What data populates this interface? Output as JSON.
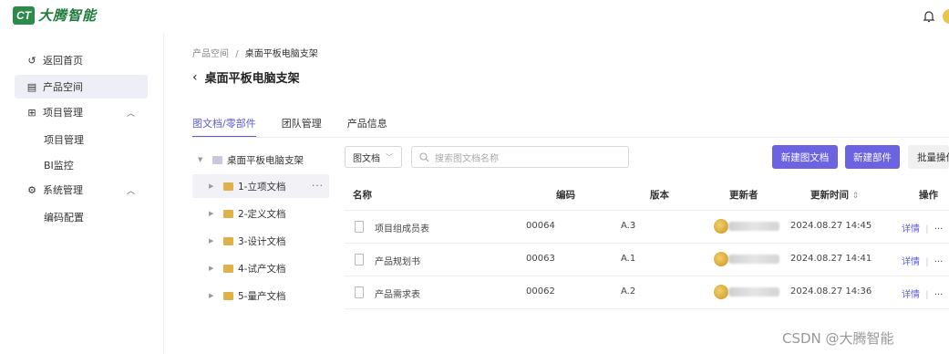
{
  "brand": {
    "logo_mark": "CT",
    "name": "大腾智能"
  },
  "sidebar": {
    "items": [
      {
        "label": "返回首页",
        "icon": "back-arrow-icon"
      },
      {
        "label": "产品空间",
        "icon": "product-space-icon",
        "active": true
      },
      {
        "label": "项目管理",
        "icon": "grid-icon",
        "expanded": true
      },
      {
        "label": "系统管理",
        "icon": "gear-icon",
        "expanded": true
      }
    ],
    "sub_project": [
      "项目管理",
      "BI监控"
    ],
    "sub_system": [
      "编码配置"
    ]
  },
  "breadcrumb": {
    "root": "产品空间",
    "sep": "/",
    "current": "桌面平板电脑支架"
  },
  "page": {
    "title": "桌面平板电脑支架",
    "back_glyph": "‹"
  },
  "tabs": [
    {
      "label": "图文档/零部件",
      "active": true
    },
    {
      "label": "团队管理"
    },
    {
      "label": "产品信息"
    }
  ],
  "tree": {
    "root": "桌面平板电脑支架",
    "folders": [
      "1-立项文档",
      "2-定义文档",
      "3-设计文档",
      "4-试产文档",
      "5-量产文档"
    ],
    "more": "···"
  },
  "toolbar": {
    "type_select": "图文档",
    "search_placeholder": "搜索图文档名称",
    "new_doc": "新建图文档",
    "new_part": "新建部件",
    "batch": "批量操作"
  },
  "table": {
    "headers": {
      "name": "名称",
      "code": "编码",
      "version": "版本",
      "updater": "更新者",
      "time": "更新时间",
      "action": "操作"
    },
    "sort_glyph": "⇕",
    "rows": [
      {
        "name": "项目组成员表",
        "code": "00064",
        "version": "A.3",
        "time": "2024.08.27 14:45",
        "detail": "详情",
        "sep": "|",
        "more": "···"
      },
      {
        "name": "产品规划书",
        "code": "00063",
        "version": "A.1",
        "time": "2024.08.27 14:41",
        "detail": "详情",
        "sep": "|",
        "more": "···"
      },
      {
        "name": "产品需求表",
        "code": "00062",
        "version": "A.2",
        "time": "2024.08.27 14:36",
        "detail": "详情",
        "sep": "|",
        "more": "···"
      }
    ]
  },
  "watermark": "CSDN @大腾智能",
  "colors": {
    "brand_green": "#2c8a4b",
    "accent": "#6b63e0",
    "folder": "#e0b14a"
  }
}
